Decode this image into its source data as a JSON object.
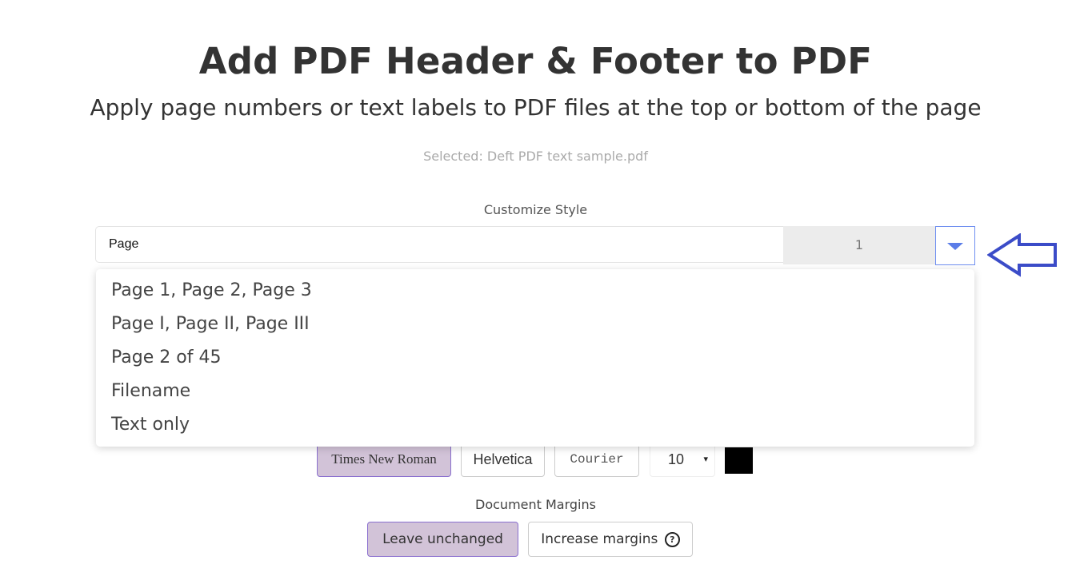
{
  "header": {
    "title": "Add PDF Header & Footer to PDF",
    "subtitle": "Apply page numbers or text labels to PDF files at the top or bottom of the page",
    "selected_file": "Selected: Deft PDF text sample.pdf"
  },
  "customize": {
    "label": "Customize Style",
    "text_value": "Page",
    "start_number": "1",
    "dropdown_icon": "caret-down-icon",
    "annotation_arrow_icon": "arrow-left-outline-icon",
    "menu_items": [
      "Page 1, Page 2, Page 3",
      "Page I, Page II, Page III",
      "Page 2 of 45",
      "Filename",
      "Text only"
    ]
  },
  "font": {
    "options": [
      "Times New Roman",
      "Helvetica",
      "Courier"
    ],
    "selected": "Times New Roman",
    "size": "10",
    "size_caret": "▾",
    "color": "#000000"
  },
  "margins": {
    "label": "Document Margins",
    "options": [
      "Leave unchanged",
      "Increase margins"
    ],
    "selected": "Leave unchanged",
    "help_icon": "?"
  },
  "colors": {
    "accent_blue": "#5b7de8",
    "active_bg": "#d2c3d8",
    "active_border": "#8a6fcf",
    "arrow": "#3b4cc8"
  }
}
